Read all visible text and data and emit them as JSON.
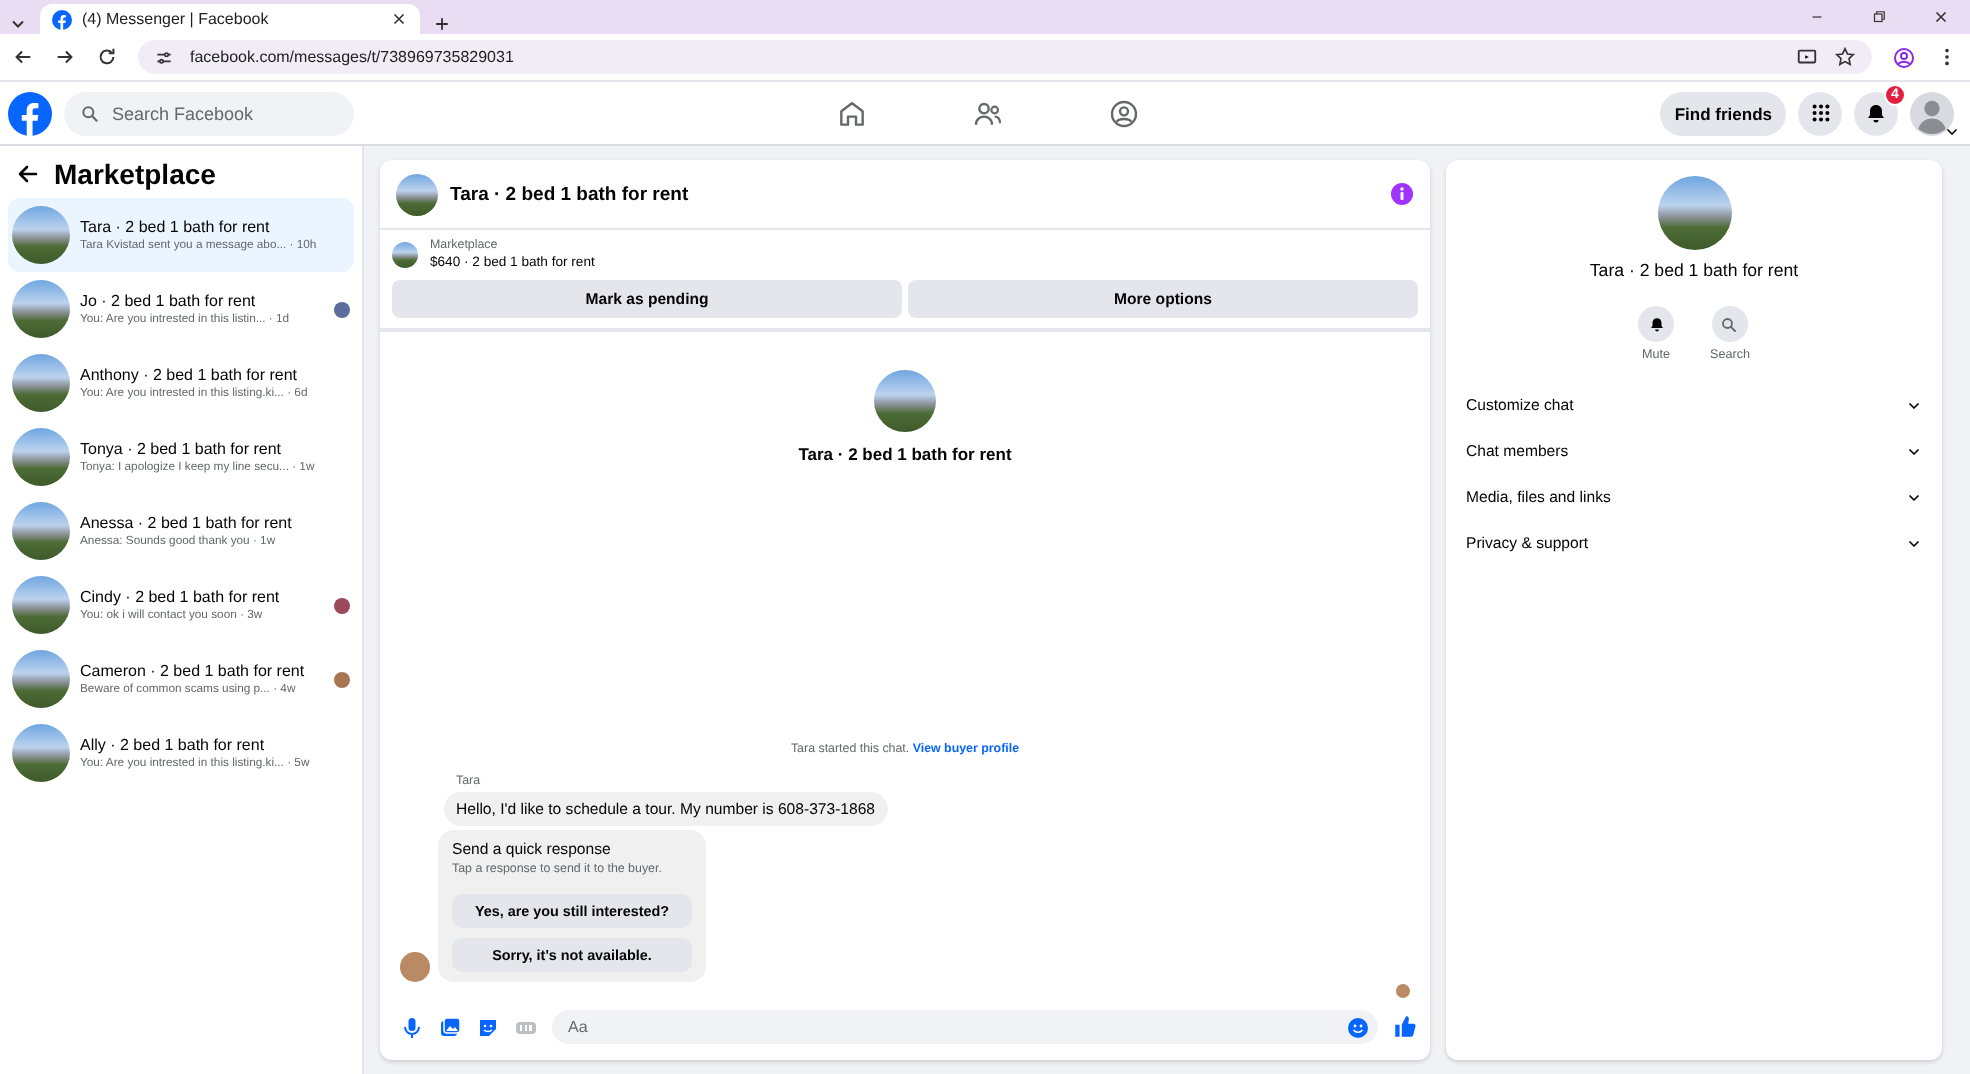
{
  "browser": {
    "tab_title": "(4) Messenger | Facebook",
    "url": "facebook.com/messages/t/738969735829031"
  },
  "topbar": {
    "search_placeholder": "Search Facebook",
    "find_friends": "Find friends",
    "notification_count": "4"
  },
  "sidebar": {
    "title": "Marketplace",
    "conversations": [
      {
        "title": "Tara · 2 bed 1 bath for rent",
        "snippet": "Tara Kvistad sent you a message abo... · 10h",
        "selected": true,
        "seen": false
      },
      {
        "title": "Jo · 2 bed 1 bath for rent",
        "snippet": "You: Are you intrested in this listin... · 1d",
        "selected": false,
        "seen": true
      },
      {
        "title": "Anthony · 2 bed 1 bath for rent",
        "snippet": "You: Are you intrested in this listing.ki... · 6d",
        "selected": false,
        "seen": false
      },
      {
        "title": "Tonya · 2 bed 1 bath for rent",
        "snippet": "Tonya: I apologize I keep my line secu... · 1w",
        "selected": false,
        "seen": false
      },
      {
        "title": "Anessa · 2 bed 1 bath for rent",
        "snippet": "Anessa: Sounds good thank you · 1w",
        "selected": false,
        "seen": false
      },
      {
        "title": "Cindy · 2 bed 1 bath for rent",
        "snippet": "You: ok i will contact you soon · 3w",
        "selected": false,
        "seen": true
      },
      {
        "title": "Cameron · 2 bed 1 bath for rent",
        "snippet": "Beware of common scams using p... · 4w",
        "selected": false,
        "seen": true
      },
      {
        "title": "Ally · 2 bed 1 bath for rent",
        "snippet": "You: Are you intrested in this listing.ki... · 5w",
        "selected": false,
        "seen": false
      }
    ]
  },
  "chat": {
    "title": "Tara · 2 bed 1 bath for rent",
    "listing": {
      "source": "Marketplace",
      "name": "$640 · 2 bed 1 bath for rent"
    },
    "actions": [
      "Mark as pending",
      "More options"
    ],
    "intro_title": "Tara · 2 bed 1 bath for rent",
    "started": {
      "text": "Tara started this chat.",
      "link": "View buyer profile"
    },
    "sender": "Tara",
    "message": "Hello, I'd like to schedule a tour. My number is 608-373-1868",
    "quick_response": {
      "title": "Send a quick response",
      "hint": "Tap a response to send it to the buyer.",
      "options": [
        "Yes, are you still interested?",
        "Sorry, it's not available."
      ]
    },
    "composer_placeholder": "Aa"
  },
  "info": {
    "title": "Tara · 2 bed 1 bath for rent",
    "actions": [
      {
        "kind": "mute",
        "label": "Mute"
      },
      {
        "kind": "search",
        "label": "Search"
      }
    ],
    "sections": [
      {
        "label": "Customize chat",
        "expanded": false
      },
      {
        "label": "Chat members",
        "expanded": false
      },
      {
        "label": "Media, files and links",
        "expanded": false
      },
      {
        "label": "Privacy & support",
        "expanded": false
      }
    ]
  }
}
